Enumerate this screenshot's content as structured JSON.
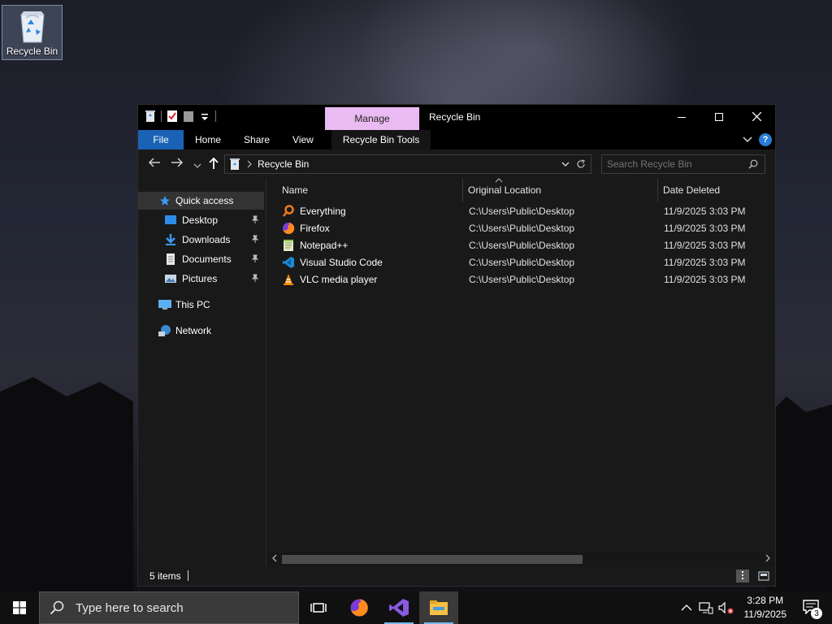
{
  "desktop": {
    "recycle_bin_label": "Recycle Bin"
  },
  "window": {
    "title": "Recycle Bin",
    "manage_tab": "Manage",
    "ribbon_tabs": [
      "File",
      "Home",
      "Share",
      "View"
    ],
    "contextual_tab": "Recycle Bin Tools",
    "address": "Recycle Bin",
    "search_placeholder": "Search Recycle Bin",
    "nav_pane": {
      "quick_access": "Quick access",
      "pinned": [
        {
          "label": "Desktop",
          "icon": "desktop-folder-icon"
        },
        {
          "label": "Downloads",
          "icon": "downloads-folder-icon"
        },
        {
          "label": "Documents",
          "icon": "documents-folder-icon"
        },
        {
          "label": "Pictures",
          "icon": "pictures-folder-icon"
        }
      ],
      "this_pc": "This PC",
      "network": "Network"
    },
    "columns": [
      "Name",
      "Original Location",
      "Date Deleted"
    ],
    "files": [
      {
        "name": "Everything",
        "location": "C:\\Users\\Public\\Desktop",
        "date": "11/9/2025 3:03 PM",
        "icon": "everything-icon"
      },
      {
        "name": "Firefox",
        "location": "C:\\Users\\Public\\Desktop",
        "date": "11/9/2025 3:03 PM",
        "icon": "firefox-icon"
      },
      {
        "name": "Notepad++",
        "location": "C:\\Users\\Public\\Desktop",
        "date": "11/9/2025 3:03 PM",
        "icon": "notepadpp-icon"
      },
      {
        "name": "Visual Studio Code",
        "location": "C:\\Users\\Public\\Desktop",
        "date": "11/9/2025 3:03 PM",
        "icon": "vscode-icon"
      },
      {
        "name": "VLC media player",
        "location": "C:\\Users\\Public\\Desktop",
        "date": "11/9/2025 3:03 PM",
        "icon": "vlc-icon"
      }
    ],
    "status": "5 items"
  },
  "taskbar": {
    "search_placeholder": "Type here to search",
    "time": "3:28 PM",
    "date": "11/9/2025",
    "notification_count": "3"
  },
  "colors": {
    "accent_blue": "#1a62b5",
    "manage_pink": "#eabbf2",
    "window_bg": "#191919"
  }
}
